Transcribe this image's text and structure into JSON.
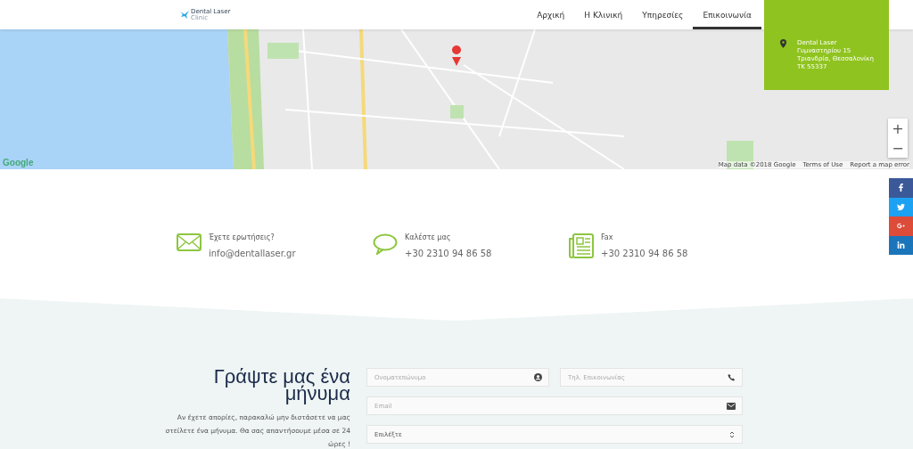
{
  "header": {
    "logo": {
      "name": "Dental Laser",
      "tagline": "Clinic"
    },
    "nav": [
      {
        "label": "Αρχική",
        "selected": false
      },
      {
        "label": "Η Κλινική",
        "selected": false
      },
      {
        "label": "Υπηρεσίες",
        "selected": false
      },
      {
        "label": "Επικοινωνία",
        "selected": true
      }
    ]
  },
  "map": {
    "logo": "Google",
    "address": [
      "Dental Laser",
      "Γυμναστηρίου 15",
      "Τριανδρία, Θεσσαλονίκη",
      "ΤΚ 55337"
    ],
    "zoom_in": "+",
    "zoom_out": "−",
    "attribution": "Map data ©2018 Google",
    "terms": "Terms of Use",
    "report": "Report a map error"
  },
  "social": [
    {
      "kind": "facebook",
      "color": "#3b5998"
    },
    {
      "kind": "twitter",
      "color": "#1da1f2"
    },
    {
      "kind": "google",
      "color": "#dd4b39"
    },
    {
      "kind": "linkedin",
      "color": "#1b75bb"
    }
  ],
  "contacts": [
    {
      "kind": "mail",
      "title": "Έχετε ερωτήσεις?",
      "value": "info@dentallaser.gr"
    },
    {
      "kind": "chat",
      "title": "Καλέστε μας",
      "value": "+30 2310 94 86 58"
    },
    {
      "kind": "fax",
      "title": "Fax",
      "value": "+30 2310 94 86 58"
    }
  ],
  "form": {
    "heading": "Γράψτε μας ένα μήνυμα",
    "intro": "Αν έχετε απορίες, παρακαλώ μην διστάσετε να μας στείλετε ένα μήνυμα. Θα σας απαντήσουμε μέσα σε 24 ώρες !",
    "fields": [
      {
        "kind": "name",
        "placeholder": "Ονοματεπώνυμο"
      },
      {
        "kind": "phone",
        "placeholder": "Τηλ. Επικοινωνίας"
      },
      {
        "kind": "email",
        "placeholder": "Email"
      },
      {
        "kind": "select",
        "value": "Επιλέξτε"
      }
    ]
  }
}
